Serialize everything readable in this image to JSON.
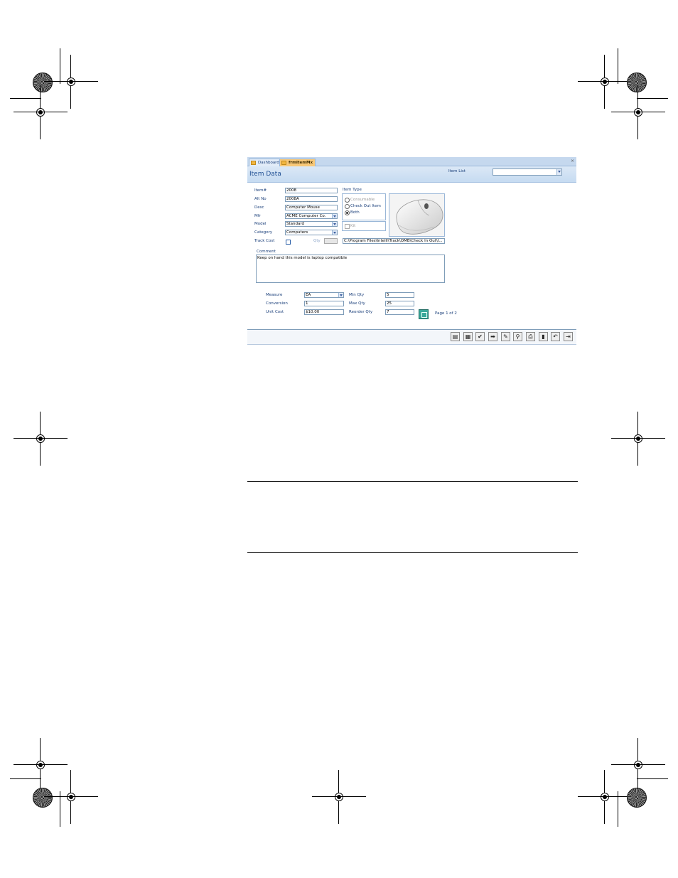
{
  "tabs": [
    {
      "label": "Dashboard"
    },
    {
      "label": "frmItemMx"
    }
  ],
  "header": {
    "title": "Item Data",
    "item_list_label": "Item List",
    "item_list_value": ""
  },
  "fields": {
    "item_label": "Item#",
    "item_value": "2008",
    "alt_label": "Alt No",
    "alt_value": "2008A",
    "desc_label": "Desc",
    "desc_value": "Computer Mouse",
    "mfr_label": "Mfr",
    "mfr_value": "ACME Computer Co.",
    "model_label": "Model",
    "model_value": "Standard",
    "category_label": "Category",
    "category_value": "Computers",
    "track_cost_label": "Track Cost",
    "qty_label": "Qty",
    "image_path": "C:\\Program Files\\Intelli\\Track\\OMB\\Check In Out\\I..."
  },
  "item_type": {
    "legend": "Item Type",
    "options": [
      {
        "label": "Consumable"
      },
      {
        "label": "Check Out Item"
      },
      {
        "label": "Both"
      }
    ],
    "selected": "Both",
    "kit_label": "Kit"
  },
  "comment": {
    "label": "Comment",
    "text": "Keep on hand this model is laptop compatible"
  },
  "measure": {
    "measure_label": "Measure",
    "measure_value": "EA",
    "conversion_label": "Conversion",
    "conversion_value": "1",
    "unit_cost_label": "Unit Cost",
    "unit_cost_value": "$10.00",
    "min_qty_label": "Min Qty",
    "min_qty_value": "5",
    "max_qty_label": "Max Qty",
    "max_qty_value": "25",
    "reorder_qty_label": "Reorder Qty",
    "reorder_qty_value": "7",
    "page_label": "Page 1 of 2"
  },
  "toolbar": {
    "buttons": [
      {
        "icon": "new-record-icon",
        "glyph": "▤"
      },
      {
        "icon": "calculator-icon",
        "glyph": "▦"
      },
      {
        "icon": "checkmark-icon",
        "glyph": "✔"
      },
      {
        "icon": "arrow-right-icon",
        "glyph": "➡"
      },
      {
        "icon": "find-replace-icon",
        "glyph": "✎"
      },
      {
        "icon": "search-icon",
        "glyph": "⚲"
      },
      {
        "icon": "print-icon",
        "glyph": "⎙"
      },
      {
        "icon": "delete-icon",
        "glyph": "▮"
      },
      {
        "icon": "undo-icon",
        "glyph": "↶"
      },
      {
        "icon": "exit-icon",
        "glyph": "⇥"
      }
    ]
  }
}
